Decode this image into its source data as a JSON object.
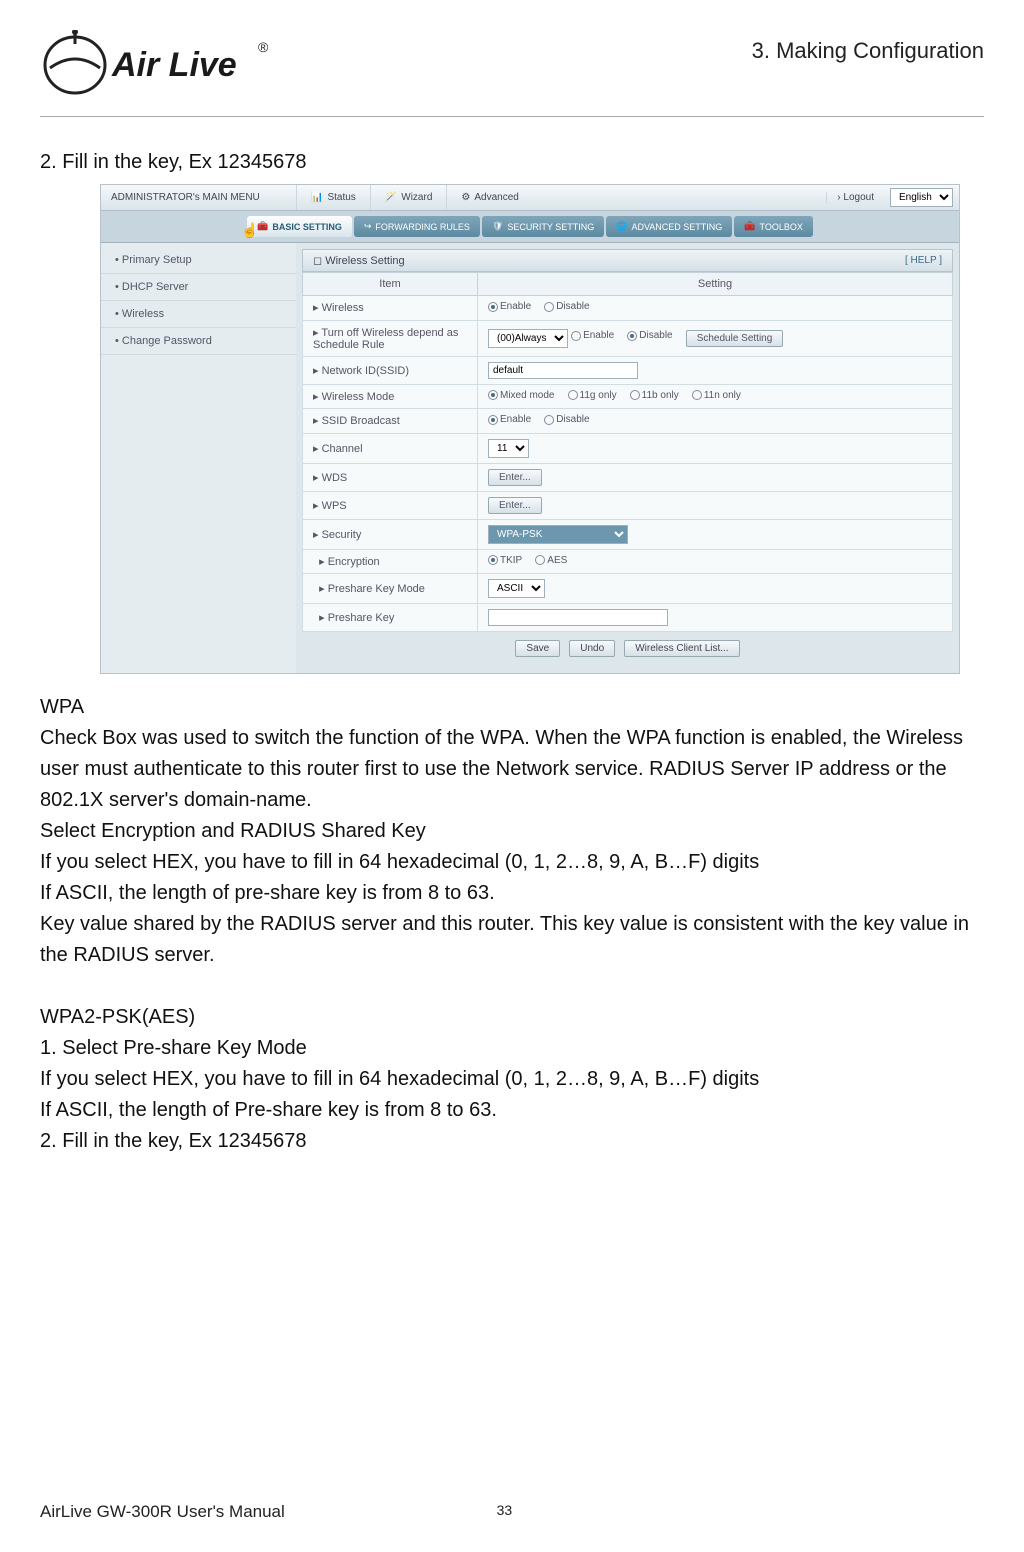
{
  "header": {
    "section": "3. Making Configuration"
  },
  "logo": {
    "text": "Air Live",
    "reg": "®"
  },
  "intro_line": "2. Fill in the key, Ex 12345678",
  "screenshot": {
    "topbar": {
      "admin": "ADMINISTRATOR's MAIN MENU",
      "status": "Status",
      "wizard": "Wizard",
      "advanced": "Advanced",
      "logout": "› Logout",
      "lang": "English"
    },
    "tabs": {
      "basic": "BASIC SETTING",
      "forwarding": "FORWARDING RULES",
      "security": "SECURITY SETTING",
      "adv": "ADVANCED SETTING",
      "toolbox": "TOOLBOX"
    },
    "side": {
      "primary": "Primary Setup",
      "dhcp": "DHCP Server",
      "wireless": "Wireless",
      "changepw": "Change Password"
    },
    "panel": {
      "title": "Wireless Setting",
      "help": "[ HELP ]",
      "th_item": "Item",
      "th_setting": "Setting",
      "rows": {
        "wireless": "Wireless",
        "turnoff": "Turn off Wireless depend as Schedule Rule",
        "ssid": "Network ID(SSID)",
        "wmode": "Wireless Mode",
        "bcast": "SSID Broadcast",
        "channel": "Channel",
        "wds": "WDS",
        "wps": "WPS",
        "sec": "Security",
        "enc": "Encryption",
        "pkmode": "Preshare Key Mode",
        "pkey": "Preshare Key"
      },
      "vals": {
        "enable": "Enable",
        "disable": "Disable",
        "always": "(00)Always",
        "schedbtn": "Schedule Setting",
        "ssidval": "default",
        "mixed": "Mixed mode",
        "m11g": "11g only",
        "m11b": "11b only",
        "m11n": "11n only",
        "chval": "11",
        "enter": "Enter...",
        "secsel": "WPA-PSK",
        "tkip": "TKIP",
        "aes": "AES",
        "ascii": "ASCII"
      },
      "buttons": {
        "save": "Save",
        "undo": "Undo",
        "wclist": "Wireless Client List..."
      }
    }
  },
  "para": {
    "wpa_h": "WPA",
    "wpa1": "Check Box was used to switch the function of the WPA. When the WPA function is enabled, the Wireless user must authenticate to this router first to use the Network service. RADIUS Server IP address or the 802.1X server's domain-name.",
    "wpa2": "Select Encryption and RADIUS Shared Key",
    "wpa3": "If you select HEX, you have to fill in 64 hexadecimal (0, 1, 2…8, 9, A, B…F) digits",
    "wpa4": "If ASCII, the length of pre-share key is from 8 to 63.",
    "wpa5": "Key value shared by the RADIUS server and this router. This key value is consistent with the key value in the RADIUS server.",
    "wpa2psk_h": "WPA2-PSK(AES)",
    "s1": "1. Select Pre-share Key Mode",
    "s12": "If you select HEX, you have to fill in 64 hexadecimal (0, 1, 2…8, 9, A, B…F) digits",
    "s13": "If ASCII, the length of Pre-share key is from 8 to 63.",
    "s2": "2. Fill in the key, Ex 12345678"
  },
  "footer": {
    "manual": "AirLive GW-300R User's Manual",
    "page": "33"
  }
}
